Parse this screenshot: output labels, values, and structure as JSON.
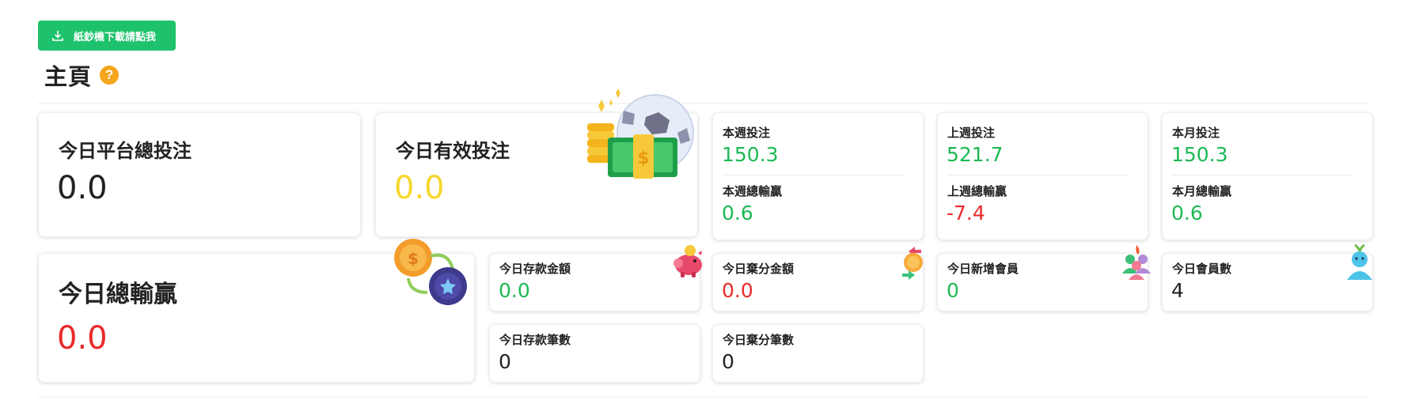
{
  "download_button": {
    "label": "紙鈔機下載請點我"
  },
  "page": {
    "title": "主頁",
    "help": "?"
  },
  "cards": {
    "today_platform_bet": {
      "label": "今日平台總投注",
      "value": "0.0"
    },
    "today_valid_bet": {
      "label": "今日有效投注",
      "value": "0.0"
    },
    "today_total_win_loss": {
      "label": "今日總輸贏",
      "value": "0.0"
    },
    "week": {
      "bet_label": "本週投注",
      "bet_value": "150.3",
      "winloss_label": "本週總輸贏",
      "winloss_value": "0.6"
    },
    "last_week": {
      "bet_label": "上週投注",
      "bet_value": "521.7",
      "winloss_label": "上週總輸贏",
      "winloss_value": "-7.4"
    },
    "month": {
      "bet_label": "本月投注",
      "bet_value": "150.3",
      "winloss_label": "本月總輸贏",
      "winloss_value": "0.6"
    },
    "today_deposit_amount": {
      "label": "今日存款金額",
      "value": "0.0"
    },
    "today_withdraw_amount": {
      "label": "今日棄分金額",
      "value": "0.0"
    },
    "today_new_members": {
      "label": "今日新增會員",
      "value": "0"
    },
    "today_members": {
      "label": "今日會員數",
      "value": "4"
    },
    "today_deposit_count": {
      "label": "今日存款筆數",
      "value": "0"
    },
    "today_withdraw_count": {
      "label": "今日棄分筆數",
      "value": "0"
    }
  },
  "icons": {
    "download": "download-icon",
    "help": "question-circle-icon",
    "money": "soccer-money-icon",
    "coin_swap": "coin-swap-icon",
    "piggy": "piggy-bank-icon",
    "withdraw": "coin-exchange-icon",
    "new_members": "user-group-icon",
    "members": "user-icon"
  },
  "colors": {
    "primary_green": "#1fc26c",
    "value_green": "#1db954",
    "value_red": "#ea2a2a",
    "value_yellow": "#f8d72c",
    "help_orange": "#f5a61c"
  }
}
